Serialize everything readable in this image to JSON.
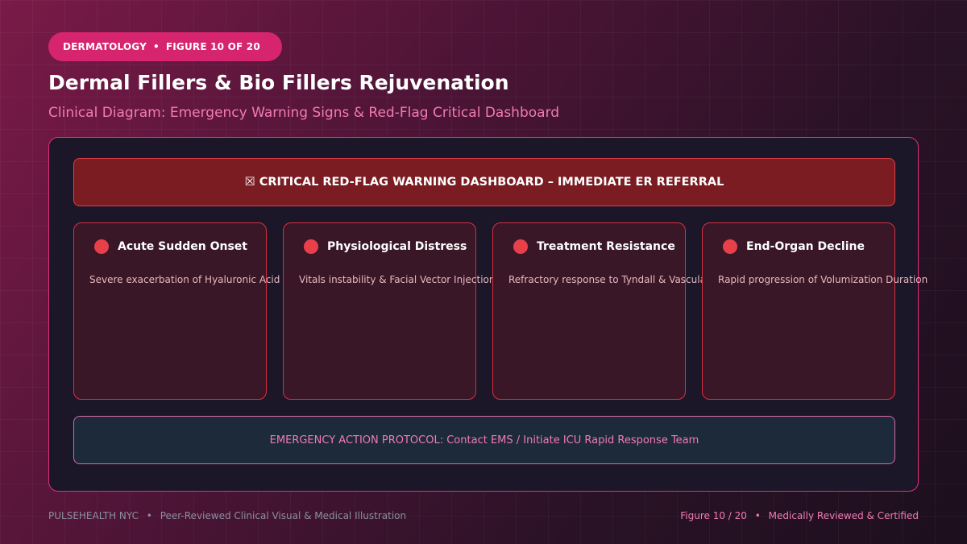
{
  "header": {
    "tag": "DERMATOLOGY",
    "tag_separator": "•",
    "figure_label": "FIGURE 10 OF 20",
    "title": "Dermal Fillers & Bio Fillers Rejuvenation",
    "subtitle": "Clinical Diagram: Emergency Warning Signs & Red-Flag Critical Dashboard"
  },
  "dashboard": {
    "banner": "☒ CRITICAL RED-FLAG WARNING DASHBOARD – IMMEDIATE ER REFERRAL",
    "cards": [
      {
        "title": "Acute Sudden Onset",
        "description": "Severe exacerbation of Hyaluronic Acid / Bio Fillers"
      },
      {
        "title": "Physiological Distress",
        "description": "Vitals instability & Facial Vector Injection"
      },
      {
        "title": "Treatment Resistance",
        "description": "Refractory response to Tyndall & Vascular Safety"
      },
      {
        "title": "End-Organ Decline",
        "description": "Rapid progression of Volumization Duration"
      }
    ],
    "protocol": "EMERGENCY ACTION PROTOCOL: Contact EMS / Initiate ICU Rapid Response Team"
  },
  "footer": {
    "brand": "PULSEHEALTH NYC",
    "separator": "•",
    "tagline": "Peer-Reviewed Clinical Visual & Medical Illustration",
    "figure": "Figure 10 / 20",
    "certification": "Medically Reviewed & Certified"
  },
  "colors": {
    "accent_pink": "#d6246e",
    "warning_red": "#e8404a",
    "banner_red": "#7a1c22",
    "subtitle_pink": "#f27bb4"
  }
}
